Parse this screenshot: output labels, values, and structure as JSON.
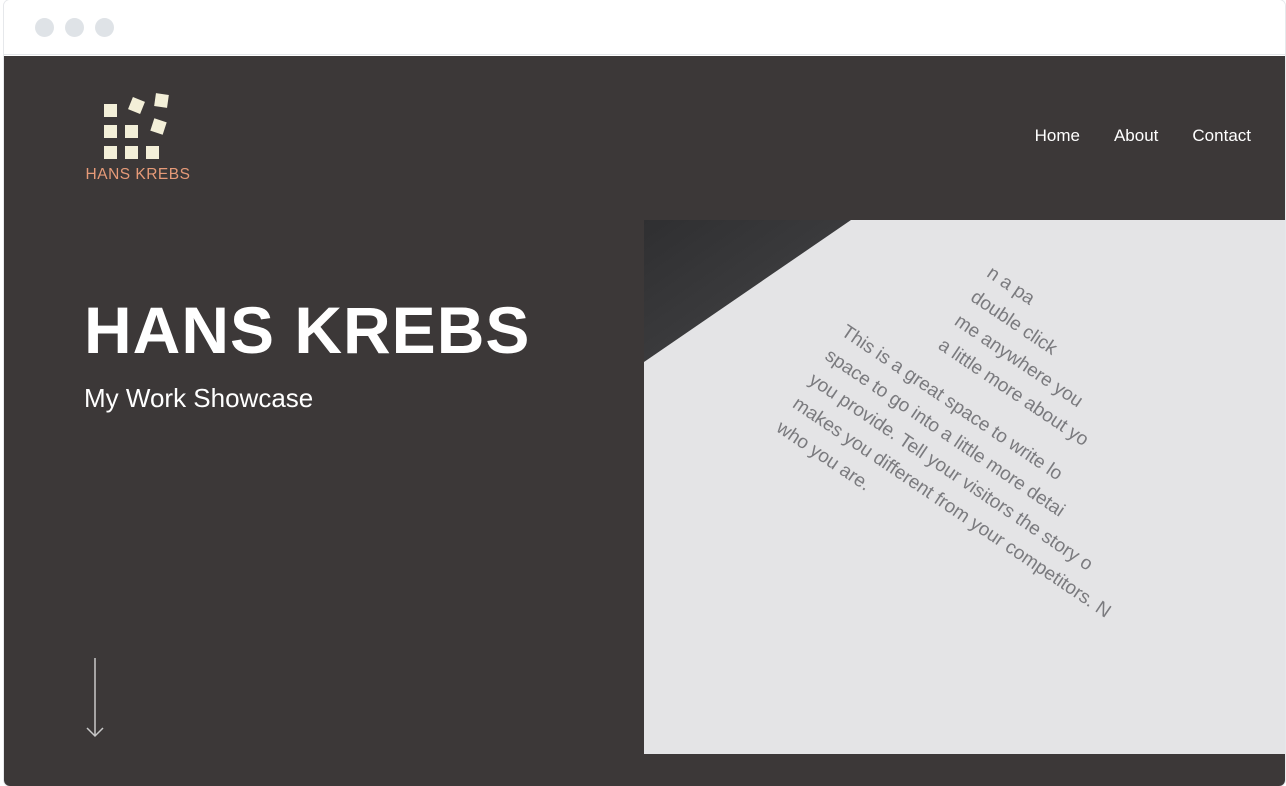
{
  "window": {
    "controls": [
      "close",
      "minimize",
      "maximize"
    ]
  },
  "logo": {
    "text": "HANS KREBS",
    "text_color": "#e69a78",
    "tile_color": "#f3efd8"
  },
  "nav": {
    "items": [
      "Home",
      "About",
      "Contact"
    ]
  },
  "hero": {
    "title": "HANS KREBS",
    "subtitle": "My Work Showcase",
    "background": "#3c3838",
    "scroll_icon": "arrow-down-icon"
  },
  "photo": {
    "lines_top": [
      "n a pa",
      "double click",
      "me anywhere you",
      "a little more about yo"
    ],
    "lines_bottom": [
      "This is a great space to write lo",
      "space to go into a little more detai",
      "you provide. Tell your visitors the story o",
      "makes you different from your competitors. N",
      "who you are."
    ]
  }
}
